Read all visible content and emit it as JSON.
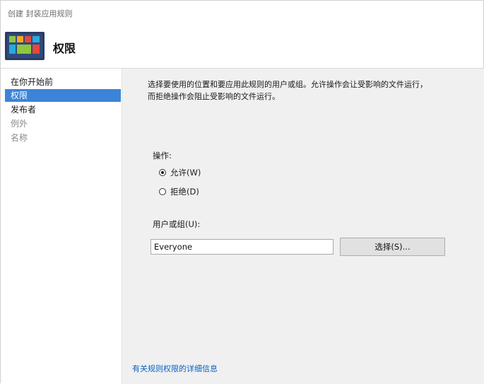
{
  "window": {
    "title": "创建 封装应用规则",
    "heading": "权限"
  },
  "sidebar": {
    "items": [
      {
        "label": "在你开始前",
        "state": "done"
      },
      {
        "label": "权限",
        "state": "active"
      },
      {
        "label": "发布者",
        "state": "done"
      },
      {
        "label": "例外",
        "state": "disabled"
      },
      {
        "label": "名称",
        "state": "disabled"
      }
    ]
  },
  "main": {
    "description_line1": "选择要使用的位置和要应用此规则的用户或组。允许操作会让受影响的文件运行，",
    "description_line2": "而拒绝操作会阻止受影响的文件运行。",
    "action_label": "操作:",
    "action_options": [
      {
        "label": "允许(W)",
        "selected": true
      },
      {
        "label": "拒绝(D)",
        "selected": false
      }
    ],
    "user_group_label": "用户或组(U):",
    "user_group_value": "Everyone",
    "select_button_label": "选择(S)...",
    "help_link": "有关规则权限的详细信息"
  },
  "colors": {
    "accent": "#3b84d8",
    "link": "#0b62c4",
    "content_bg": "#f0f0f0"
  },
  "icons": {
    "header": "applocker-rule-icon"
  }
}
